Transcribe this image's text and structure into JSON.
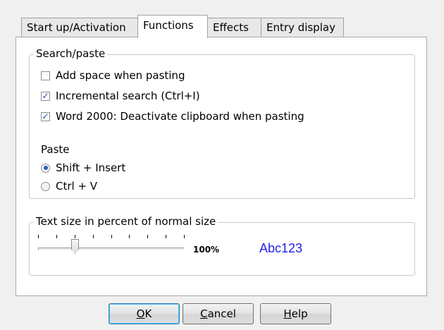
{
  "tabs": [
    {
      "label": "Start up/Activation",
      "active": false
    },
    {
      "label": "Functions",
      "active": true
    },
    {
      "label": "Effects",
      "active": false
    },
    {
      "label": "Entry display",
      "active": false
    }
  ],
  "search_paste": {
    "title": "Search/paste",
    "options": [
      {
        "label": "Add space when pasting",
        "checked": false
      },
      {
        "label": "Incremental search (Ctrl+I)",
        "checked": true
      },
      {
        "label": "Word 2000: Deactivate clipboard when pasting",
        "checked": true
      }
    ],
    "paste_label": "Paste",
    "paste_options": [
      {
        "label": "Shift + Insert",
        "selected": true
      },
      {
        "label": "Ctrl + V",
        "selected": false
      }
    ]
  },
  "text_size": {
    "title": "Text size in percent of normal size",
    "value_label": "100%",
    "slider_position": 0.25,
    "tick_count": 9,
    "sample_text": "Abc123",
    "sample_color": "#2020ee"
  },
  "buttons": {
    "ok": {
      "accel": "O",
      "rest": "K"
    },
    "cancel": {
      "accel": "C",
      "rest": "ancel"
    },
    "help": {
      "accel": "H",
      "rest": "elp"
    }
  }
}
